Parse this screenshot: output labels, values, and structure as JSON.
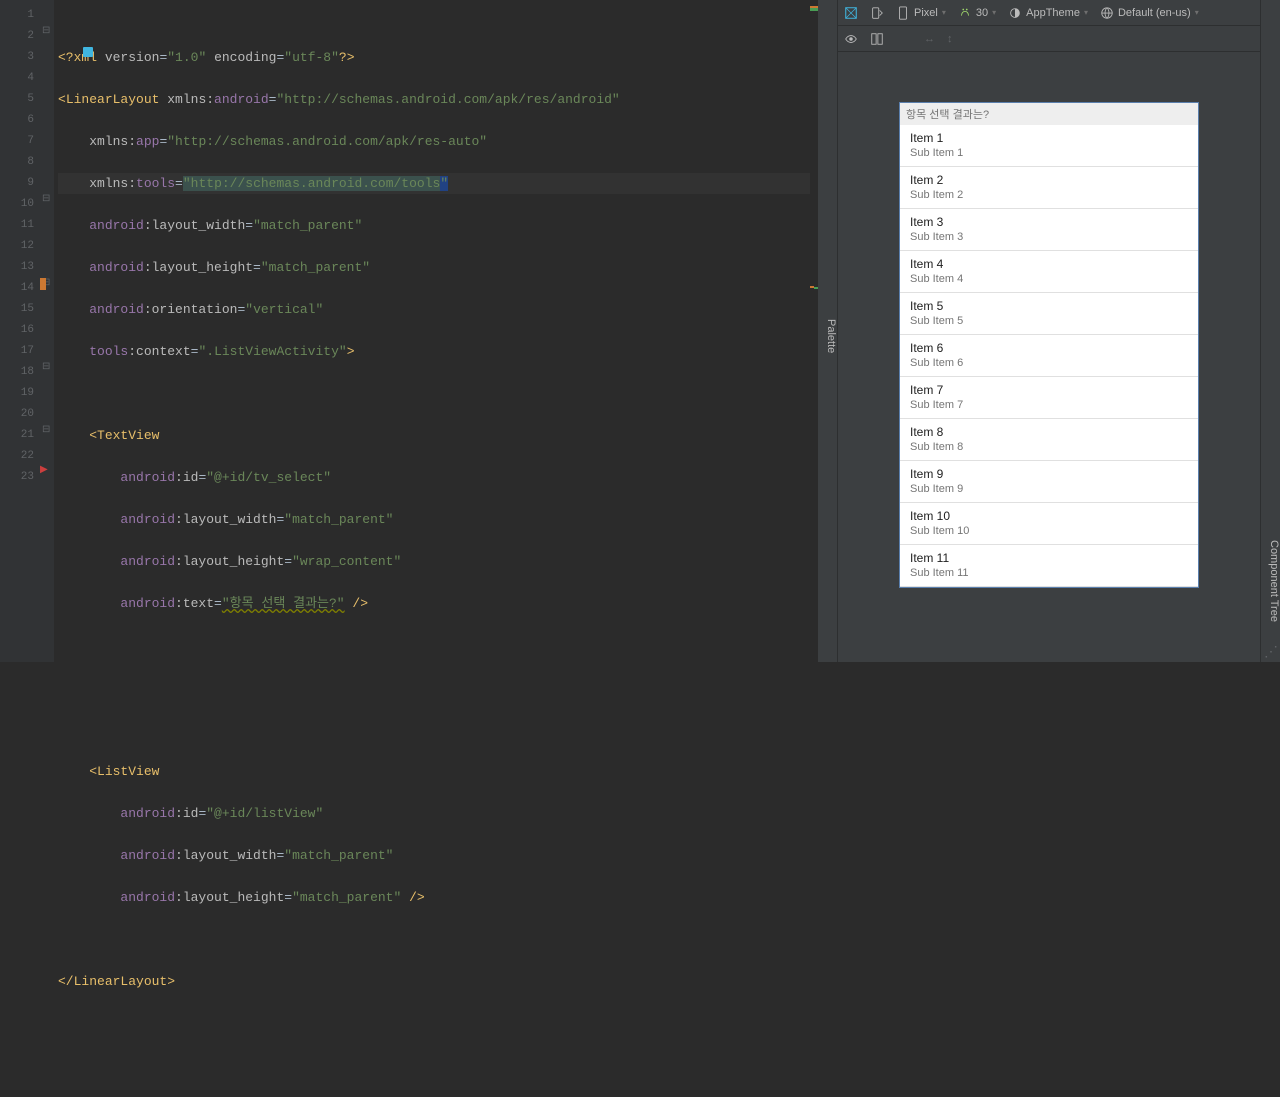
{
  "gutter_lines": [
    "1",
    "2",
    "3",
    "4",
    "5",
    "6",
    "7",
    "8",
    "9",
    "10",
    "11",
    "12",
    "13",
    "14",
    "15",
    "16",
    "17",
    "18",
    "19",
    "20",
    "21",
    "22",
    "23"
  ],
  "code": {
    "l1_open": "<?",
    "l1_tag": "xml",
    "l1_a1": " version",
    "l1_eq": "=",
    "l1_v1": "\"1.0\"",
    "l1_a2": " encoding",
    "l1_v2": "\"utf-8\"",
    "l1_close": "?>",
    "l2_open": "<",
    "l2_tag": "LinearLayout",
    "l2_a": " xmlns:",
    "l2_ns": "android",
    "l2_v": "\"http://schemas.android.com/apk/res/android\"",
    "l3_a": "xmlns:",
    "l3_ns": "app",
    "l3_v": "\"http://schemas.android.com/apk/res-auto\"",
    "l4_a": "xmlns:",
    "l4_ns": "tools",
    "l4_eq": "=",
    "l4_v": "\"http://schemas.android.com/tools\"",
    "l5_ns": "android",
    "l5_a": ":layout_width",
    "l5_v": "\"match_parent\"",
    "l6_ns": "android",
    "l6_a": ":layout_height",
    "l6_v": "\"match_parent\"",
    "l7_ns": "android",
    "l7_a": ":orientation",
    "l7_v": "\"vertical\"",
    "l8_ns": "tools",
    "l8_a": ":context",
    "l8_v": "\".ListViewActivity\"",
    "l8_close": ">",
    "l10_open": "<",
    "l10_tag": "TextView",
    "l11_ns": "android",
    "l11_a": ":id",
    "l11_v": "\"@+id/tv_select\"",
    "l12_ns": "android",
    "l12_a": ":layout_width",
    "l12_v": "\"match_parent\"",
    "l13_ns": "android",
    "l13_a": ":layout_height",
    "l13_v": "\"wrap_content\"",
    "l14_ns": "android",
    "l14_a": ":text",
    "l14_v": "\"항목 선택 결과는?\"",
    "l14_close": " />",
    "l18_open": "<",
    "l18_tag": "ListView",
    "l19_ns": "android",
    "l19_a": ":id",
    "l19_v": "\"@+id/listView\"",
    "l20_ns": "android",
    "l20_a": ":layout_width",
    "l20_v": "\"match_parent\"",
    "l21_ns": "android",
    "l21_a": ":layout_height",
    "l21_v": "\"match_parent\"",
    "l21_close": " />",
    "l23_open": "</",
    "l23_tag": "LinearLayout",
    "l23_close": ">"
  },
  "toolbar": {
    "device": "Pixel",
    "api": "30",
    "theme": "AppTheme",
    "locale": "Default (en-us)"
  },
  "preview": {
    "header": "항목 선택 결과는?",
    "items": [
      {
        "t": "Item 1",
        "s": "Sub Item 1"
      },
      {
        "t": "Item 2",
        "s": "Sub Item 2"
      },
      {
        "t": "Item 3",
        "s": "Sub Item 3"
      },
      {
        "t": "Item 4",
        "s": "Sub Item 4"
      },
      {
        "t": "Item 5",
        "s": "Sub Item 5"
      },
      {
        "t": "Item 6",
        "s": "Sub Item 6"
      },
      {
        "t": "Item 7",
        "s": "Sub Item 7"
      },
      {
        "t": "Item 8",
        "s": "Sub Item 8"
      },
      {
        "t": "Item 9",
        "s": "Sub Item 9"
      },
      {
        "t": "Item 10",
        "s": "Sub Item 10"
      },
      {
        "t": "Item 11",
        "s": "Sub Item 11"
      }
    ]
  },
  "sidebars": {
    "palette": "Palette",
    "tree": "Component Tree"
  }
}
